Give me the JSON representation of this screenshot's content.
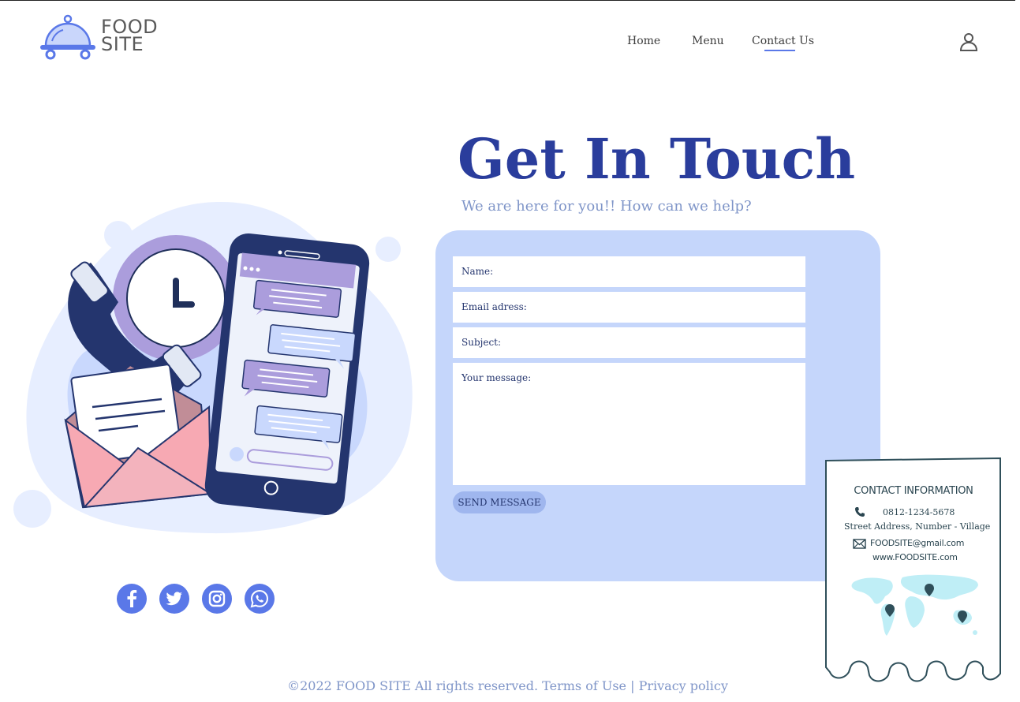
{
  "brand": {
    "line1": "FOOD",
    "line2": "SITE"
  },
  "nav": {
    "home": "Home",
    "menu": "Menu",
    "contact": "Contact Us",
    "active": "contact"
  },
  "hero": {
    "title": "Get In Touch",
    "subtitle": "We are here for you!! How can we help?"
  },
  "form": {
    "name_label": "Name:",
    "email_label": "Email adress:",
    "subject_label": "Subject:",
    "message_label": "Your message:",
    "name_value": "",
    "email_value": "",
    "subject_value": "",
    "message_value": "",
    "send_label": "SEND MESSAGE"
  },
  "contact_info": {
    "title": "CONTACT INFORMATION",
    "phone": "0812-1234-5678",
    "address": "Street Address, Number - Village",
    "email": "FOODSITE@gmail.com",
    "website": "www.FOODSITE.com"
  },
  "social": {
    "icons": [
      "facebook-icon",
      "twitter-icon",
      "instagram-icon",
      "whatsapp-icon"
    ]
  },
  "footer": {
    "copyright": "©2022 FOOD SITE All rights reserved.",
    "terms": "Terms of Use",
    "separator": "|",
    "privacy": "Privacy policy"
  },
  "colors": {
    "accent": "#5a78e8",
    "title": "#2a3d9c",
    "card_bg": "#c5d6fb",
    "muted_text": "#7f95c8",
    "dark_navy": "#24356e"
  }
}
